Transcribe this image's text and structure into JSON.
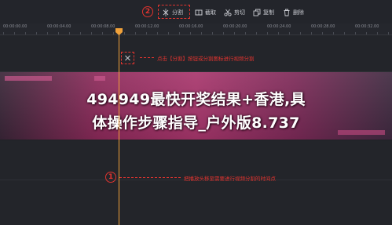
{
  "toolbar": {
    "badge_number": "2",
    "items": [
      {
        "label": "分割",
        "icon": "split-icon"
      },
      {
        "label": "截取",
        "icon": "trim-icon"
      },
      {
        "label": "剪切",
        "icon": "scissors-icon"
      },
      {
        "label": "复制",
        "icon": "copy-icon"
      },
      {
        "label": "删除",
        "icon": "trash-icon"
      }
    ]
  },
  "ruler": {
    "ticks": [
      "00:00:00.00",
      "00:00:04.00",
      "00:00:08.00",
      "00:00:12.00",
      "00:00:16.00",
      "00:00:20.00",
      "00:00:24.00",
      "00:00:28.00",
      "00:00:32.00"
    ]
  },
  "annotations": {
    "split_hint": "点击【分割】按钮或分割图标进行视频分割",
    "playhead_hint": "把播放头移至需要进行视频分割的时间点",
    "playhead_badge": "1"
  },
  "overlay": {
    "title_line1": "494949最快开奖结果+香港,具",
    "title_line2": "体操作步骤指导_户外版8.737"
  },
  "colors": {
    "accent_red": "#e0342f",
    "playhead": "#f0a13a",
    "background": "#1f2126"
  }
}
